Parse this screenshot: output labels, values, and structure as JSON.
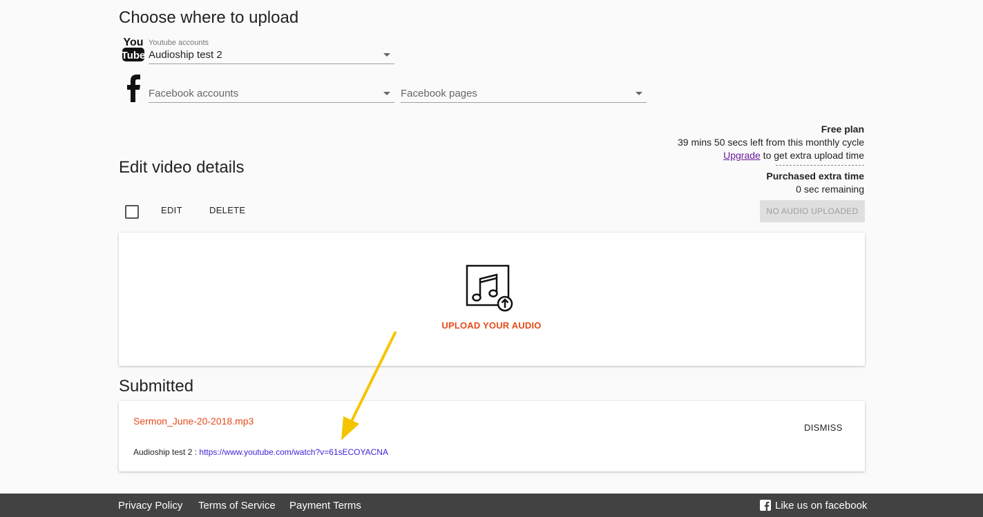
{
  "upload_section": {
    "title": "Choose where to upload",
    "youtube": {
      "label": "Youtube accounts",
      "value": "Audioship test 2"
    },
    "facebook": {
      "accounts_placeholder": "Facebook accounts",
      "pages_placeholder": "Facebook pages"
    }
  },
  "plan": {
    "title": "Free plan",
    "remaining": "39 mins 50 secs left from this monthly cycle",
    "upgrade_link": "Upgrade",
    "upgrade_suffix": " to get extra upload time",
    "extra_title": "Purchased extra time",
    "extra_remaining": "0 sec remaining"
  },
  "edit_section": {
    "title": "Edit video details",
    "edit_label": "EDIT",
    "delete_label": "DELETE",
    "status_button": "NO AUDIO UPLOADED",
    "upload_label": "UPLOAD YOUR AUDIO"
  },
  "submitted": {
    "title": "Submitted",
    "filename": "Sermon_June-20-2018.mp3",
    "account": "Audioship test 2 : ",
    "url": "https://www.youtube.com/watch?v=61sECOYACNA",
    "dismiss_label": "DISMISS"
  },
  "footer": {
    "privacy": "Privacy Policy",
    "terms": "Terms of Service",
    "payment": "Payment Terms",
    "facebook": "Like us on facebook"
  },
  "colors": {
    "accent": "#e64a19",
    "link": "#3f1fd6",
    "annotation_arrow": "#f5c400",
    "footer_bg": "#424242"
  }
}
